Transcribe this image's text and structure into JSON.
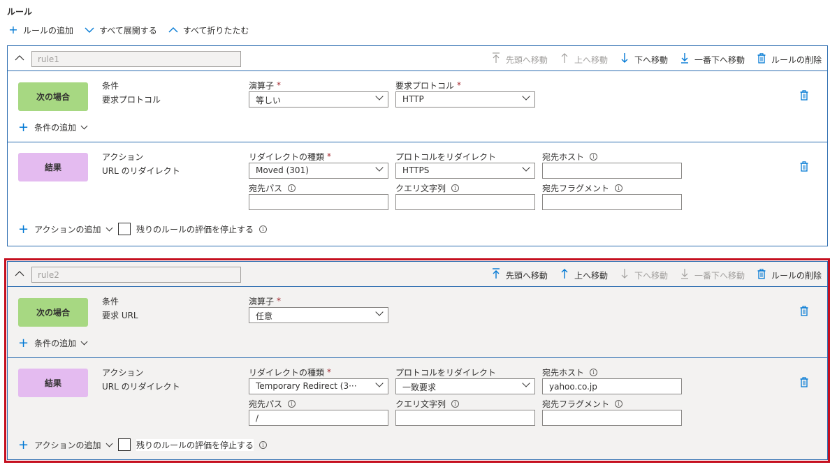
{
  "title": "ルール",
  "toolbar": {
    "add_rule": "ルールの追加",
    "expand_all": "すべて展開する",
    "collapse_all": "すべて折りたたむ"
  },
  "head_actions": {
    "move_top": "先頭へ移動",
    "move_up": "上へ移動",
    "move_down": "下へ移動",
    "move_bottom": "一番下へ移動",
    "delete_rule": "ルールの削除"
  },
  "labels": {
    "if_pill": "次の場合",
    "result_pill": "結果",
    "condition": "条件",
    "action": "アクション",
    "operator": "演算子",
    "request_protocol": "要求プロトコル",
    "redirect_type": "リダイレクトの種類",
    "redirect_protocol": "プロトコルをリダイレクト",
    "dest_host": "宛先ホスト",
    "dest_path": "宛先パス",
    "query_string": "クエリ文字列",
    "dest_fragment": "宛先フラグメント",
    "add_condition": "条件の追加",
    "add_action": "アクションの追加",
    "stop_evaluating": "残りのルールの評価を停止する",
    "required": "*"
  },
  "rules": [
    {
      "name": "rule1",
      "condition_type": "要求プロトコル",
      "operator": "等しい",
      "request_protocol": "HTTP",
      "action_type": "URL のリダイレクト",
      "redirect_type": "Moved (301)",
      "redirect_protocol": "HTTPS",
      "dest_host": "",
      "dest_path": "",
      "query_string": "",
      "dest_fragment": ""
    },
    {
      "name": "rule2",
      "condition_type": "要求 URL",
      "operator": "任意",
      "action_type": "URL のリダイレクト",
      "redirect_type": "Temporary Redirect (3···",
      "redirect_protocol": "一致要求",
      "dest_host": "yahoo.co.jp",
      "dest_path": "/",
      "query_string": "",
      "dest_fragment": ""
    }
  ],
  "colors": {
    "accent": "#0078d4",
    "condition_pill": "#a7d882",
    "result_pill": "#e4bbf0",
    "selected_outline": "#c50f1f"
  }
}
